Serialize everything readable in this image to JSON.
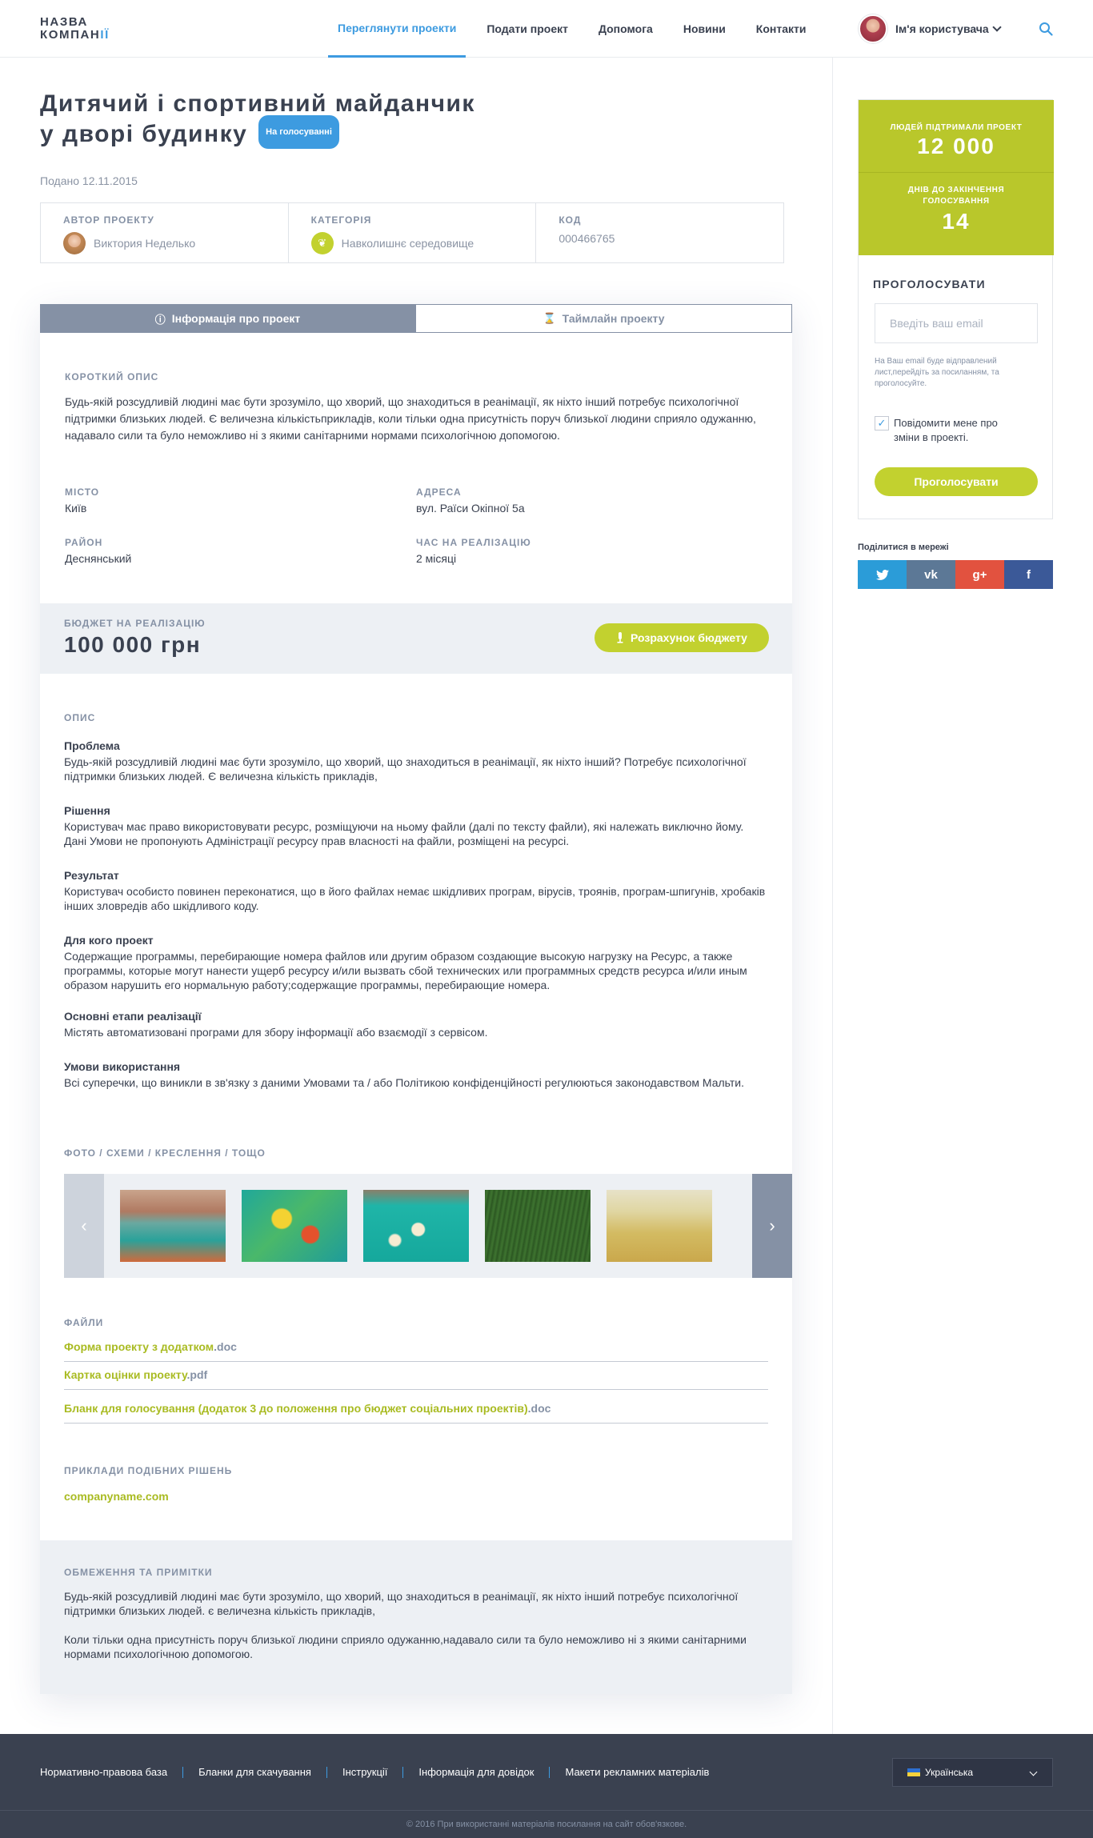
{
  "header": {
    "logo_line1": "НАЗВА",
    "logo_line2a": "КОМПАН",
    "logo_line2b": "ІЇ",
    "nav": [
      "Переглянути проекти",
      "Подати проект",
      "Допомога",
      "Новини",
      "Контакти"
    ],
    "active_nav": "Переглянути проекти",
    "user_name": "Ім'я користувача"
  },
  "project": {
    "title_line1": "Дитячий і спортивний майданчик",
    "title_line2": "у дворі будинку",
    "status": "На голосуванні",
    "submitted": "Подано 12.11.2015",
    "author_label": "Автор проекту",
    "author": "Виктория Неделько",
    "category_label": "Категорія",
    "category": "Навколишнє середовище",
    "code_label": "Код",
    "code": "000466765"
  },
  "tabs": {
    "info": "Інформація про проект",
    "timeline": "Таймлайн проекту"
  },
  "info": {
    "short_label": "Короткий опис",
    "short_text": "Будь-якій розсудливій людині має бути зрозуміло, що хворий, що знаходиться в реанімації, як ніхто інший потребує психологічної підтримки близьких людей. Є величезна кількістьприкладів, коли тільки одна присутність поруч близької людини сприяло одужанню, надавало сили та було неможливо ні з якими санітарними нормами психологічною допомогою.",
    "city_label": "Місто",
    "city": "Київ",
    "address_label": "Адреса",
    "address": "вул. Раїси Окіпної 5а",
    "district_label": "Район",
    "district": "Деснянський",
    "time_label": "Час на реалізацію",
    "time": "2 місяці"
  },
  "budget": {
    "label": "Бюджет на реалізацію",
    "amount": "100 000 грн",
    "button": "Розрахунок бюджету"
  },
  "description": {
    "label": "Опис",
    "sections": [
      {
        "h": "Проблема",
        "t": "Будь-якій розсудливій людині має бути зрозуміло, що хворий, що знаходиться в реанімації, як ніхто інший? Потребує психологічної підтримки близьких людей. Є величезна кількість прикладів,"
      },
      {
        "h": "Рішення",
        "t": "Користувач має право використовувати ресурс, розміщуючи на ньому файли (далі по тексту файли), які належать виключно йому. Дані Умови не пропонують Адміністрації ресурсу прав власності на файли, розміщені на ресурсі."
      },
      {
        "h": "Результат",
        "t": "Користувач особисто повинен переконатися, що в його файлах немає шкідливих програм, вірусів, троянів, програм-шпигунів, хробаків інших зловредів або шкідливого коду."
      },
      {
        "h": "Для кого проект",
        "t": "Содержащие программы, перебирающие номера файлов или другим образом создающие высокую нагрузку на Ресурс, а также программы, которые могут нанести ущерб ресурсу и/или вызвать сбой технических или программных средств ресурса и/или иным образом нарушить его нормальную работу;содержащие программы, перебирающие номера."
      },
      {
        "h": "Основні етапи реалізації",
        "t": "Містять автоматизовані програми для збору інформації або взаємодії з сервісом."
      },
      {
        "h": "Умови використання",
        "t": "Всі суперечки, що виникли в зв'язку з даними Умовами та / або Політикою конфіденційності регулюються законодавством Мальти."
      }
    ]
  },
  "gallery": {
    "label": "Фото / схеми / креслення / тощо"
  },
  "files": {
    "label": "Файли",
    "items": [
      {
        "name": "Форма проекту з додатком",
        "ext": ".doc"
      },
      {
        "name": "Картка оцінки проекту",
        "ext": ".pdf"
      },
      {
        "name": "Бланк для голосування (додаток 3 до положення про бюджет соціальних проектів)",
        "ext": ".doc"
      }
    ]
  },
  "examples": {
    "label": "Приклади подібних рішень",
    "link": "companyname.com"
  },
  "notes": {
    "label": "Обмеження та примітки",
    "p1": "Будь-якій розсудливій людині має бути зрозуміло, що хворий, що знаходиться в реанімації, як ніхто інший потребує психологічної підтримки близьких людей. є величезна кількість прикладів,",
    "p2": "Коли тільки одна присутність поруч близької людини сприяло одужанню,надавало сили та було неможливо ні з якими санітарними нормами психологічною допомогою."
  },
  "vote": {
    "supporters_label": "Людей підтримали проект",
    "supporters": "12 000",
    "days_label1": "Днів до закінчення",
    "days_label2": "голосування",
    "days": "14",
    "title": "ПРОГОЛОСУВАТИ",
    "email_placeholder": "Введіть ваш email",
    "hint": "На Ваш email буде відправлений лист,перейдіть за посиланням, та проголосуйте.",
    "notify": "Повідомити мене про зміни в проекті.",
    "notify_checked": true,
    "button": "Проголосувати"
  },
  "share": {
    "label": "Поділитися в мережі",
    "networks": [
      {
        "icon": "twitter-icon",
        "glyph": "t",
        "color": "#2b9cd8"
      },
      {
        "icon": "vk-icon",
        "glyph": "vk",
        "color": "#5c7896"
      },
      {
        "icon": "google-plus-icon",
        "glyph": "g+",
        "color": "#e2523f"
      },
      {
        "icon": "facebook-icon",
        "glyph": "f",
        "color": "#3b5998"
      }
    ]
  },
  "footer": {
    "links": [
      "Нормативно-правова база",
      "Бланки для скачування",
      "Інструкції",
      "Інформація для довідок",
      "Макети рекламних матеріалів"
    ],
    "language": "Українська",
    "copyright": "© 2016 При використанні матеріалів посилання на сайт обов'язкове."
  },
  "colors": {
    "accent": "#3d9be0",
    "green": "#c2d12f",
    "dark": "#3a4150",
    "muted": "#8591a5"
  }
}
